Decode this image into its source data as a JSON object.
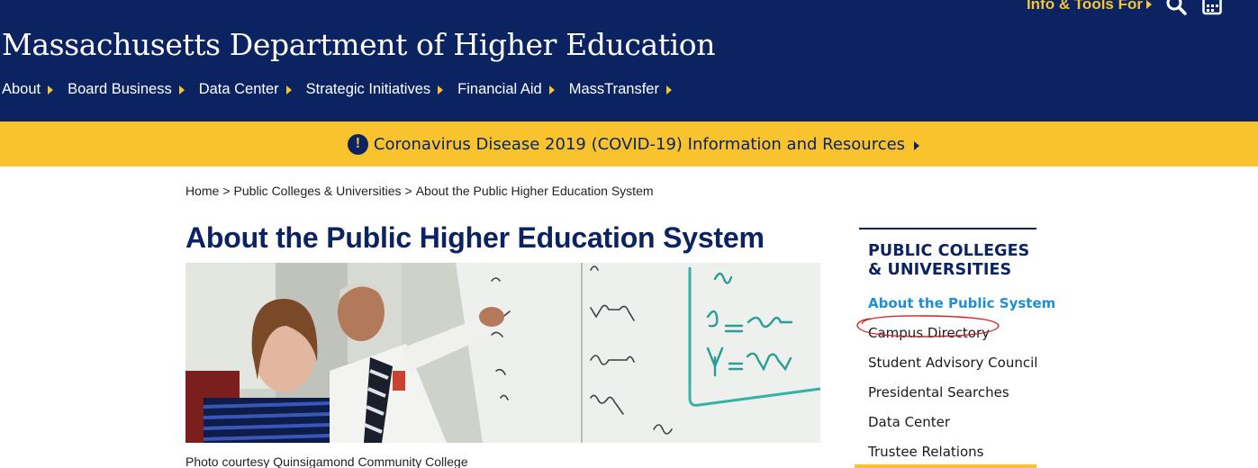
{
  "header": {
    "site_title": "Massachusetts Department of Higher Education",
    "utility_link": "Info & Tools For",
    "utility_icons": [
      "search-icon",
      "calendar-icon"
    ],
    "nav": [
      {
        "label": "About"
      },
      {
        "label": "Board Business"
      },
      {
        "label": "Data Center"
      },
      {
        "label": "Strategic Initiatives"
      },
      {
        "label": "Financial Aid"
      },
      {
        "label": "MassTransfer"
      }
    ],
    "colors": {
      "navy": "#0c2361",
      "gold": "#f9c32e"
    }
  },
  "alert": {
    "icon": "exclamation-icon",
    "text": "Coronavirus Disease 2019 (COVID-19) Information and Resources"
  },
  "breadcrumb": {
    "items": [
      "Home",
      "Public Colleges & Universities",
      "About the Public Higher Education System"
    ],
    "separator": ">"
  },
  "main": {
    "title": "About the Public Higher Education System",
    "photo_caption": "Photo courtesy Quinsigamond Community College"
  },
  "sidebar": {
    "heading": "PUBLIC COLLEGES & UNIVERSITIES",
    "items": [
      {
        "label": "About the Public System",
        "active": true
      },
      {
        "label": "Campus Directory",
        "active": false
      },
      {
        "label": "Student Advisory Council",
        "active": false
      },
      {
        "label": "Presidental Searches",
        "active": false
      },
      {
        "label": "Data Center",
        "active": false
      },
      {
        "label": "Trustee Relations",
        "active": false
      }
    ],
    "active_color": "#1f8fd1"
  }
}
